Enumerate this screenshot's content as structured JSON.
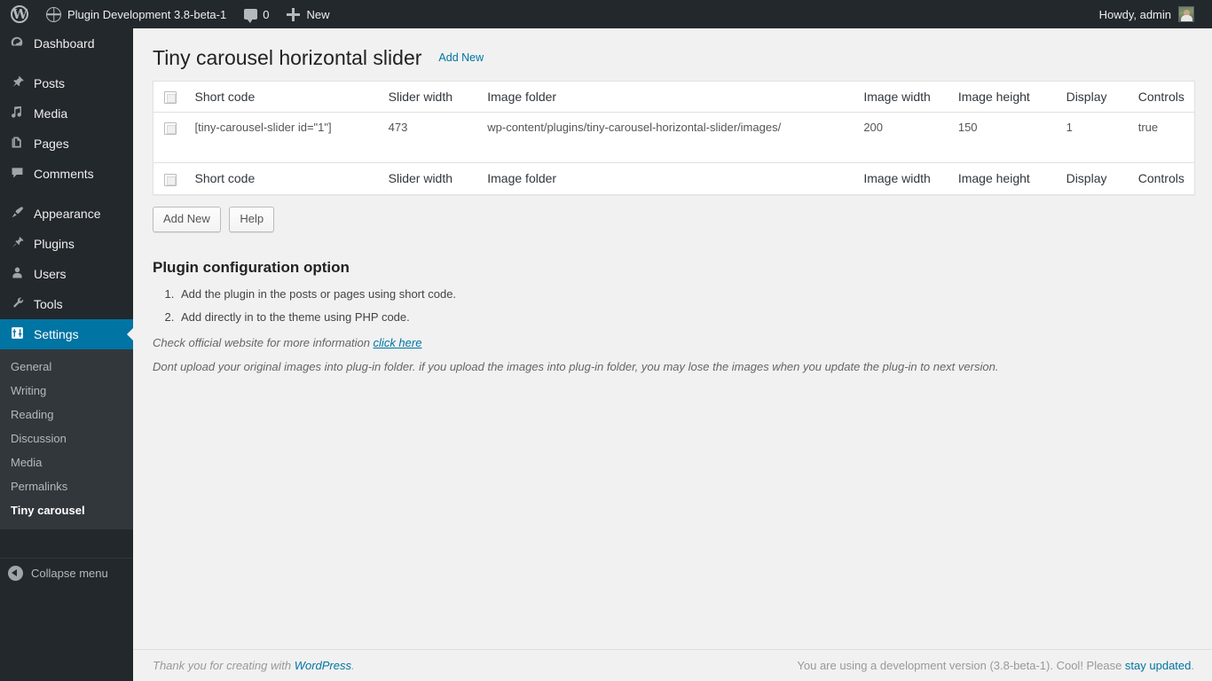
{
  "adminbar": {
    "wp_logo": "wordpress-logo-icon",
    "site_name": "Plugin Development 3.8-beta-1",
    "comments_count": "0",
    "new_label": "New",
    "howdy": "Howdy, admin"
  },
  "sidebar": {
    "items": [
      {
        "label": "Dashboard",
        "icon": "dashboard-icon"
      },
      {
        "label": "Posts",
        "icon": "pin-icon"
      },
      {
        "label": "Media",
        "icon": "media-icon"
      },
      {
        "label": "Pages",
        "icon": "pages-icon"
      },
      {
        "label": "Comments",
        "icon": "comments-icon"
      },
      {
        "label": "Appearance",
        "icon": "appearance-brush-icon"
      },
      {
        "label": "Plugins",
        "icon": "plugins-plug-icon"
      },
      {
        "label": "Users",
        "icon": "users-icon"
      },
      {
        "label": "Tools",
        "icon": "tools-wrench-icon"
      },
      {
        "label": "Settings",
        "icon": "settings-sliders-icon"
      }
    ],
    "submenu": [
      {
        "label": "General"
      },
      {
        "label": "Writing"
      },
      {
        "label": "Reading"
      },
      {
        "label": "Discussion"
      },
      {
        "label": "Media"
      },
      {
        "label": "Permalinks"
      },
      {
        "label": "Tiny carousel"
      }
    ],
    "collapse_label": "Collapse menu",
    "active_color": "#0074a2"
  },
  "page": {
    "title": "Tiny carousel horizontal slider",
    "add_new_top": "Add New"
  },
  "table": {
    "columns": [
      "Short code",
      "Slider width",
      "Image folder",
      "Image width",
      "Image height",
      "Display",
      "Controls"
    ],
    "rows": [
      {
        "short_code": "[tiny-carousel-slider id=\"1\"]",
        "slider_width": "473",
        "image_folder": "wp-content/plugins/tiny-carousel-horizontal-slider/images/",
        "image_width": "200",
        "image_height": "150",
        "display": "1",
        "controls": "true"
      }
    ]
  },
  "buttons": {
    "add_new": "Add New",
    "help": "Help"
  },
  "config": {
    "title": "Plugin configuration option",
    "steps": [
      "Add the plugin in the posts or pages using short code.",
      "Add directly in to the theme using PHP code."
    ],
    "note1_prefix": "Check official website for more information ",
    "note1_link": "click here",
    "note2": "Dont upload your original images into plug-in folder. if you upload the images into plug-in folder, you may lose the images when you update the plug-in to next version."
  },
  "footer": {
    "left_prefix": "Thank you for creating with ",
    "left_link": "WordPress",
    "left_suffix": ".",
    "right_prefix": "You are using a development version (3.8-beta-1). Cool! Please ",
    "right_link": "stay updated",
    "right_suffix": "."
  }
}
